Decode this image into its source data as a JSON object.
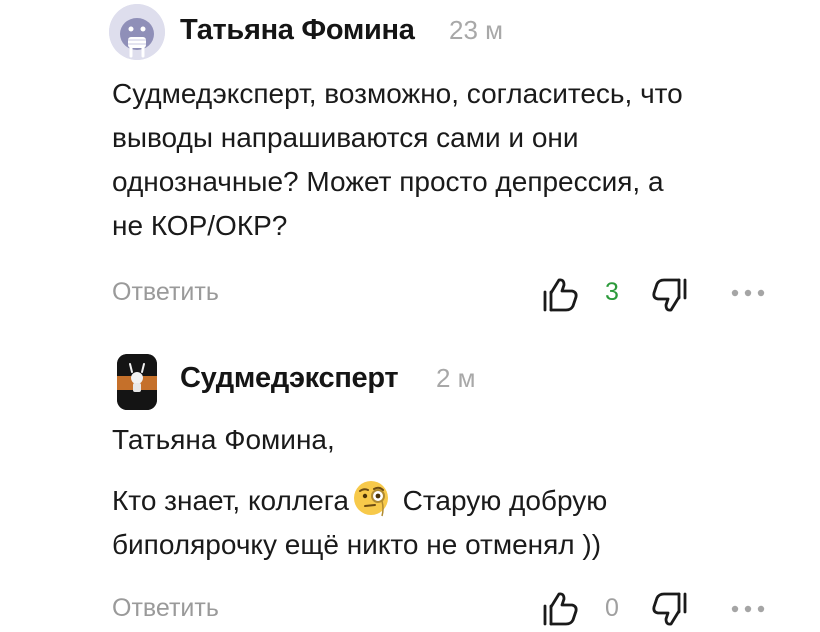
{
  "comments": [
    {
      "author": "Татьяна Фомина",
      "time": "23 м",
      "text_lines": [
        "Судмедэксперт, возможно, согласитесь, что",
        "выводы напрашиваются сами и они",
        "однозначные? Может просто депрессия, а",
        "не КОР/ОКР?"
      ],
      "reply_label": "Ответить",
      "likes": "3",
      "liked": true
    },
    {
      "author": "Судмедэксперт",
      "time": "2 м",
      "text_line1": "Татьяна Фомина,",
      "text_line2_before_emoji": "Кто знает, коллега",
      "emoji": "face-with-monocle-emoji",
      "text_line2_after_emoji": " Старую добрую",
      "text_line3": "биполярочку ещё никто не отменял ))",
      "reply_label": "Ответить",
      "likes": "0",
      "liked": false
    }
  ],
  "colors": {
    "like_active": "#2b9a3a",
    "muted": "#9a9a9a"
  }
}
